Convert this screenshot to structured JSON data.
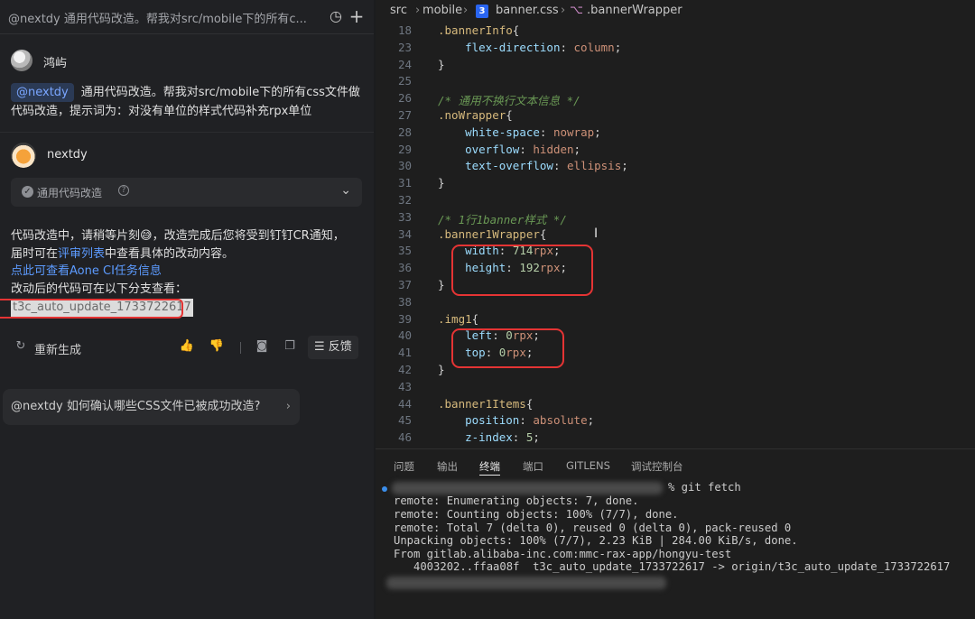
{
  "chat": {
    "header_title": "@nextdy 通用代码改造。帮我对src/mobile下的所有c...",
    "user_name": "鸿屿",
    "mention": "@nextdy",
    "question_text": "通用代码改造。帮我对src/mobile下的所有css文件做代码改造，提示词为：对没有单位的样式代码补充rpx单位",
    "bot_name": "nextdy",
    "tool_label": "通用代码改造",
    "answer_line1": "代码改造中，请稍等片刻",
    "answer_line1_tail": "，改造完成后您将受到钉钉CR通知，",
    "answer_line2_pre": "届时可在",
    "answer_line2_link": "评审列表",
    "answer_line2_post": "中查看具体的改动内容。",
    "answer_link_aone": "点此可查看Aone CI任务信息",
    "answer_branch_intro": "改动后的代码可在以下分支查看：",
    "branch_name": "t3c_auto_update_1733722617",
    "regenerate": "重新生成",
    "feedback": "反馈",
    "suggestion": "@nextdy 如何确认哪些CSS文件已被成功改造?"
  },
  "editor": {
    "breadcrumb": [
      "src",
      "mobile",
      "banner.css",
      ".bannerWrapper"
    ],
    "lines": [
      {
        "n": "18",
        "parts": [
          [
            "sel",
            ".bannerInfo"
          ],
          [
            "punc",
            "{"
          ]
        ]
      },
      {
        "n": "23",
        "parts": [
          [
            "",
            "    "
          ],
          [
            "prop",
            "flex-direction"
          ],
          [
            "punc",
            ": "
          ],
          [
            "val",
            "column"
          ],
          [
            "punc",
            ";"
          ]
        ]
      },
      {
        "n": "24",
        "parts": [
          [
            "punc",
            "}"
          ]
        ]
      },
      {
        "n": "25",
        "parts": []
      },
      {
        "n": "26",
        "parts": [
          [
            "cmt",
            "/* 通用不换行文本信息 */"
          ]
        ]
      },
      {
        "n": "27",
        "parts": [
          [
            "sel",
            ".noWrapper"
          ],
          [
            "punc",
            "{"
          ]
        ]
      },
      {
        "n": "28",
        "parts": [
          [
            "",
            "    "
          ],
          [
            "prop",
            "white-space"
          ],
          [
            "punc",
            ": "
          ],
          [
            "val",
            "nowrap"
          ],
          [
            "punc",
            ";"
          ]
        ]
      },
      {
        "n": "29",
        "parts": [
          [
            "",
            "    "
          ],
          [
            "prop",
            "overflow"
          ],
          [
            "punc",
            ": "
          ],
          [
            "val",
            "hidden"
          ],
          [
            "punc",
            ";"
          ]
        ]
      },
      {
        "n": "30",
        "parts": [
          [
            "",
            "    "
          ],
          [
            "prop",
            "text-overflow"
          ],
          [
            "punc",
            ": "
          ],
          [
            "val",
            "ellipsis"
          ],
          [
            "punc",
            ";"
          ]
        ]
      },
      {
        "n": "31",
        "parts": [
          [
            "punc",
            "}"
          ]
        ]
      },
      {
        "n": "32",
        "parts": []
      },
      {
        "n": "33",
        "parts": [
          [
            "cmt",
            "/* 1行1banner样式 */"
          ]
        ]
      },
      {
        "n": "34",
        "parts": [
          [
            "sel",
            ".banner1Wrapper"
          ],
          [
            "punc",
            "{"
          ]
        ]
      },
      {
        "n": "35",
        "parts": [
          [
            "",
            "    "
          ],
          [
            "prop",
            "width"
          ],
          [
            "punc",
            ": "
          ],
          [
            "num",
            "714"
          ],
          [
            "val",
            "rpx"
          ],
          [
            "punc",
            ";"
          ]
        ]
      },
      {
        "n": "36",
        "parts": [
          [
            "",
            "    "
          ],
          [
            "prop",
            "height"
          ],
          [
            "punc",
            ": "
          ],
          [
            "num",
            "192"
          ],
          [
            "val",
            "rpx"
          ],
          [
            "punc",
            ";"
          ]
        ]
      },
      {
        "n": "37",
        "parts": [
          [
            "punc",
            "}"
          ]
        ]
      },
      {
        "n": "38",
        "parts": []
      },
      {
        "n": "39",
        "parts": [
          [
            "sel",
            ".img1"
          ],
          [
            "punc",
            "{"
          ]
        ]
      },
      {
        "n": "40",
        "parts": [
          [
            "",
            "    "
          ],
          [
            "prop",
            "left"
          ],
          [
            "punc",
            ": "
          ],
          [
            "num",
            "0"
          ],
          [
            "val",
            "rpx"
          ],
          [
            "punc",
            ";"
          ]
        ]
      },
      {
        "n": "41",
        "parts": [
          [
            "",
            "    "
          ],
          [
            "prop",
            "top"
          ],
          [
            "punc",
            ": "
          ],
          [
            "num",
            "0"
          ],
          [
            "val",
            "rpx"
          ],
          [
            "punc",
            ";"
          ]
        ]
      },
      {
        "n": "42",
        "parts": [
          [
            "punc",
            "}"
          ]
        ]
      },
      {
        "n": "43",
        "parts": []
      },
      {
        "n": "44",
        "parts": [
          [
            "sel",
            ".banner1Items"
          ],
          [
            "punc",
            "{"
          ]
        ]
      },
      {
        "n": "45",
        "parts": [
          [
            "",
            "    "
          ],
          [
            "prop",
            "position"
          ],
          [
            "punc",
            ": "
          ],
          [
            "val",
            "absolute"
          ],
          [
            "punc",
            ";"
          ]
        ]
      },
      {
        "n": "46",
        "parts": [
          [
            "",
            "    "
          ],
          [
            "prop",
            "z-index"
          ],
          [
            "punc",
            ": "
          ],
          [
            "num",
            "5"
          ],
          [
            "punc",
            ";"
          ]
        ]
      }
    ],
    "panel_tabs": [
      "问题",
      "输出",
      "终端",
      "端口",
      "GITLENS",
      "调试控制台"
    ],
    "active_tab": "终端",
    "terminal": [
      "% git fetch",
      "remote: Enumerating objects: 7, done.",
      "remote: Counting objects: 100% (7/7), done.",
      "remote: Total 7 (delta 0), reused 0 (delta 0), pack-reused 0",
      "Unpacking objects: 100% (7/7), 2.23 KiB | 284.00 KiB/s, done.",
      "From gitlab.alibaba-inc.com:mmc-rax-app/hongyu-test",
      "   4003202..ffaa08f  t3c_auto_update_1733722617 -> origin/t3c_auto_update_1733722617"
    ]
  }
}
